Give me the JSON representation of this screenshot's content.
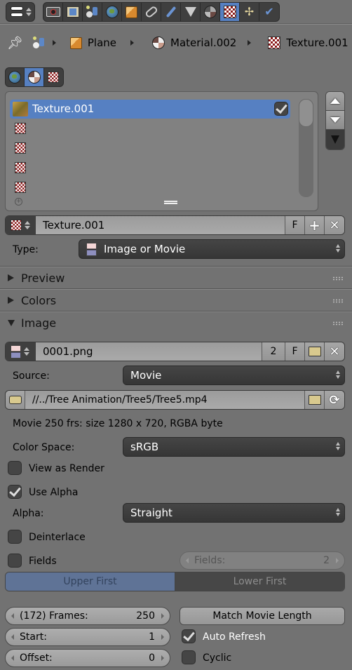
{
  "header": {
    "editor_type_icon": "properties-editor-icon",
    "context_tabs": [
      {
        "name": "render",
        "icon": "camera-icon",
        "active": false
      },
      {
        "name": "render-layers",
        "icon": "render-layers-icon",
        "active": false
      },
      {
        "name": "scene",
        "icon": "scene-icon",
        "active": false
      },
      {
        "name": "world",
        "icon": "world-icon",
        "active": false
      },
      {
        "name": "object",
        "icon": "object-cube-icon",
        "active": false
      },
      {
        "name": "constraints",
        "icon": "constraint-link-icon",
        "active": false
      },
      {
        "name": "modifiers",
        "icon": "wrench-icon",
        "active": false
      },
      {
        "name": "data",
        "icon": "mesh-data-icon",
        "active": false
      },
      {
        "name": "material",
        "icon": "material-sphere-icon",
        "active": false
      },
      {
        "name": "texture",
        "icon": "texture-checker-icon",
        "active": true
      },
      {
        "name": "particles",
        "icon": "particles-icon",
        "active": false
      },
      {
        "name": "physics",
        "icon": "physics-icon",
        "active": false
      }
    ]
  },
  "breadcrumbs": [
    {
      "label": "",
      "icon": "pin-icon"
    },
    {
      "label": "",
      "icon": "scene-icon"
    },
    {
      "label": "Plane",
      "icon": "object-cube-icon"
    },
    {
      "label": "Material.002",
      "icon": "material-sphere-icon"
    },
    {
      "label": "Texture.001",
      "icon": "texture-checker-icon"
    }
  ],
  "texture_context": {
    "tabs": [
      {
        "name": "world",
        "icon": "world-icon",
        "active": false
      },
      {
        "name": "material",
        "icon": "material-sphere-icon",
        "active": true
      },
      {
        "name": "other",
        "icon": "texture-checker-icon",
        "active": false
      }
    ]
  },
  "texture_slots": {
    "items": [
      {
        "label": "Texture.001",
        "icon": "image-thumbnail-icon",
        "selected": true,
        "enabled": true
      },
      {
        "label": "",
        "icon": "texture-checker-icon",
        "selected": false
      },
      {
        "label": "",
        "icon": "texture-checker-icon",
        "selected": false
      },
      {
        "label": "",
        "icon": "texture-checker-icon",
        "selected": false
      },
      {
        "label": "",
        "icon": "texture-checker-icon",
        "selected": false
      }
    ],
    "move_up_label": "Move up",
    "move_down_label": "Move down",
    "specials_label": "Specials"
  },
  "texture_datablock": {
    "name": "Texture.001",
    "fake_user_label": "F"
  },
  "type": {
    "label": "Type:",
    "value": "Image or Movie"
  },
  "panels": {
    "preview": {
      "title": "Preview",
      "expanded": false
    },
    "colors": {
      "title": "Colors",
      "expanded": false
    },
    "image": {
      "title": "Image",
      "expanded": true
    }
  },
  "image": {
    "datablock_name": "0001.png",
    "users": "2",
    "fake_user_label": "F",
    "source_label": "Source:",
    "source_value": "Movie",
    "filepath": "//../Tree Animation/Tree5/Tree5.mp4",
    "info": "Movie 250 frs: size 1280 x 720, RGBA byte",
    "color_space_label": "Color Space:",
    "color_space_value": "sRGB",
    "view_as_render_label": "View as Render",
    "view_as_render": false,
    "use_alpha_label": "Use Alpha",
    "use_alpha": true,
    "alpha_label": "Alpha:",
    "alpha_value": "Straight",
    "deinterlace_label": "Deinterlace",
    "deinterlace": false,
    "fields_label": "Fields",
    "fields": false,
    "fields_count_label": "Fields:",
    "fields_count": "2",
    "field_order": [
      "Upper First",
      "Lower First"
    ],
    "field_order_selected": "Upper First"
  },
  "movie": {
    "frames_label": "(172) Frames:",
    "frames_value": "250",
    "start_label": "Start:",
    "start_value": "1",
    "offset_label": "Offset:",
    "offset_value": "0",
    "match_length_label": "Match Movie Length",
    "auto_refresh_label": "Auto Refresh",
    "auto_refresh": true,
    "cyclic_label": "Cyclic",
    "cyclic": false
  },
  "colors": {
    "background": "#727272",
    "accent": "#5680c2",
    "dropdown": "#3f3f3f"
  }
}
